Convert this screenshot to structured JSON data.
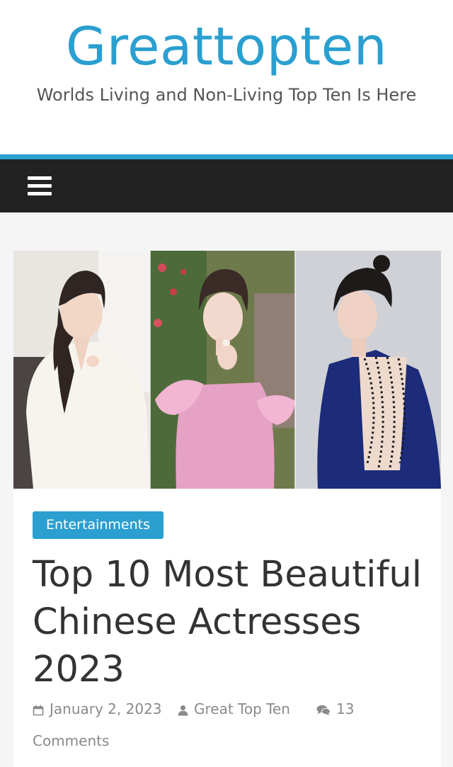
{
  "site": {
    "title": "Greattopten",
    "tagline": "Worlds Living and Non-Living Top Ten Is Here"
  },
  "nav": {
    "menu_icon": "hamburger-menu-icon"
  },
  "colors": {
    "accent": "#2a9fd0",
    "nav_background": "#222222",
    "title_text": "#333333",
    "meta_text": "#8a8a8a"
  },
  "article": {
    "featured_image": "photo collage of three actresses",
    "category": "Entertainments",
    "title": "Top 10 Most Beautiful Chinese Actresses 2023",
    "date": "January 2, 2023",
    "author": "Great Top Ten",
    "comments_count": "13",
    "comments_label": "Comments",
    "icons": {
      "date": "calendar-icon",
      "author": "user-icon",
      "comments": "comments-icon"
    }
  }
}
